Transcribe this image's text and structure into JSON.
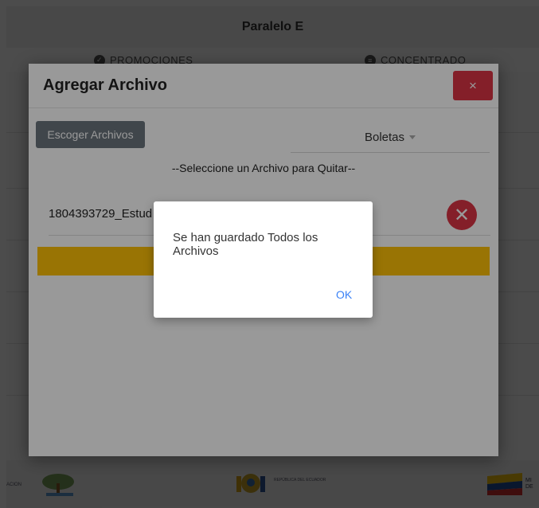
{
  "header": {
    "title": "Paralelo E"
  },
  "tabs": [
    {
      "label": "PROMOCIONES",
      "icon": "check-circle-icon"
    },
    {
      "label": "CONCENTRADO",
      "icon": "list-circle-icon"
    }
  ],
  "modal": {
    "title": "Agregar Archivo",
    "close_label": "×",
    "choose_files_label": "Escoger Archivos",
    "select_value": "Boletas",
    "remove_label": "--Seleccione un Archivo para Quitar--",
    "file_name": "1804393729_Estud",
    "delete_icon_label": "✕"
  },
  "alert": {
    "message": "Se han guardado Todos los Archivos",
    "ok_label": "OK"
  },
  "footer": {
    "logo_left_text": "ACION",
    "logo_center_text": "REPÚBLICA DEL ECUADOR",
    "logo_right_text": "MI DE"
  },
  "colors": {
    "danger": "#dc3545",
    "secondary": "#6c757d",
    "warning": "#ffc107",
    "link": "#3b82f6"
  }
}
